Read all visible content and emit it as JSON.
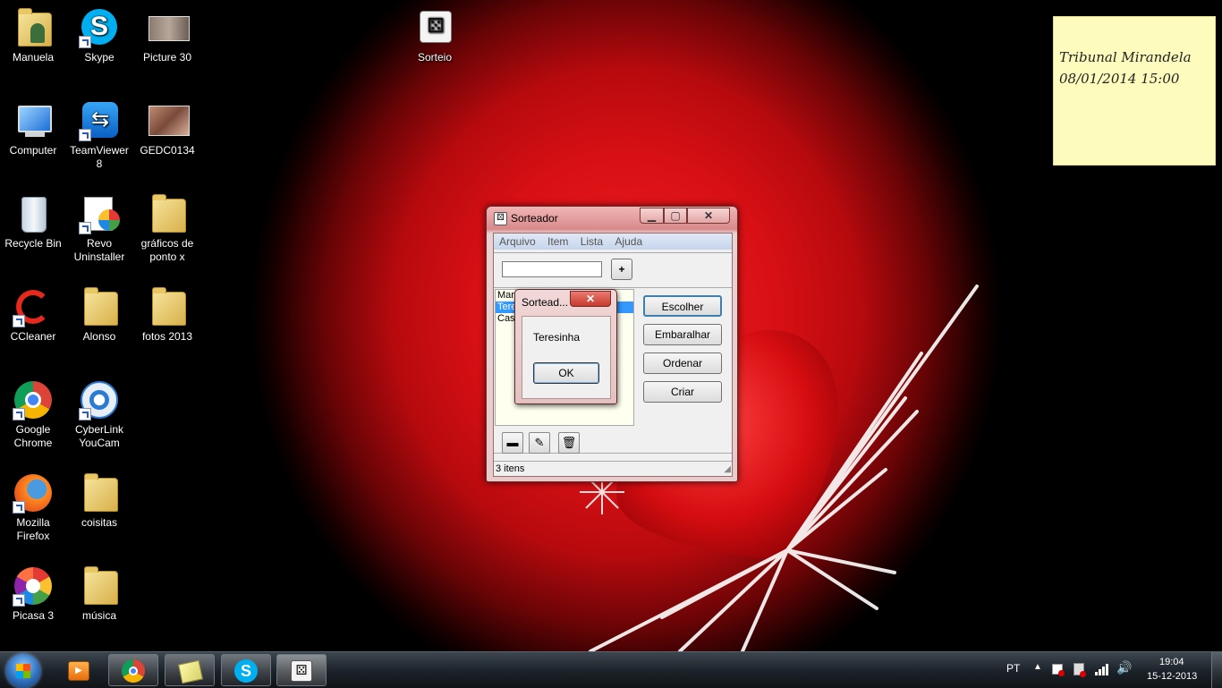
{
  "desktop_icons": [
    {
      "label": "Manuela"
    },
    {
      "label": "Skype"
    },
    {
      "label": "Picture 30"
    },
    {
      "label": "Sorteio"
    },
    {
      "label": "Computer"
    },
    {
      "label": "TeamViewer 8"
    },
    {
      "label": "GEDC0134"
    },
    {
      "label": "Recycle Bin"
    },
    {
      "label": "Revo Uninstaller"
    },
    {
      "label": "gráficos de ponto x"
    },
    {
      "label": "CCleaner"
    },
    {
      "label": "Alonso"
    },
    {
      "label": "fotos 2013"
    },
    {
      "label": "Google Chrome"
    },
    {
      "label": "CyberLink YouCam"
    },
    {
      "label": "Mozilla Firefox"
    },
    {
      "label": "coisitas"
    },
    {
      "label": "Picasa 3"
    },
    {
      "label": "música"
    }
  ],
  "sticky_note": {
    "line1": "Tribunal Mirandela",
    "line2": "08/01/2014 15:00"
  },
  "main_window": {
    "title": "Sorteador",
    "menu": [
      "Arquivo",
      "Item",
      "Lista",
      "Ajuda"
    ],
    "input_value": "",
    "add_button": "+",
    "list_items": [
      "Mari",
      "Tere",
      "Cass"
    ],
    "buttons": [
      "Escolher",
      "Embaralhar",
      "Ordenar",
      "Criar"
    ],
    "status": "3 itens"
  },
  "dialog": {
    "title": "Sortead...",
    "message": "Teresinha",
    "ok": "OK"
  },
  "tray": {
    "language": "PT",
    "time": "19:04",
    "date": "15-12-2013"
  },
  "colors": {
    "wallpaper_red": "#e81a1f",
    "titlebar": "#e3a6a6",
    "note_yellow": "#fdfcbd",
    "taskbar": "#1b2128",
    "selection": "#3399ff"
  }
}
